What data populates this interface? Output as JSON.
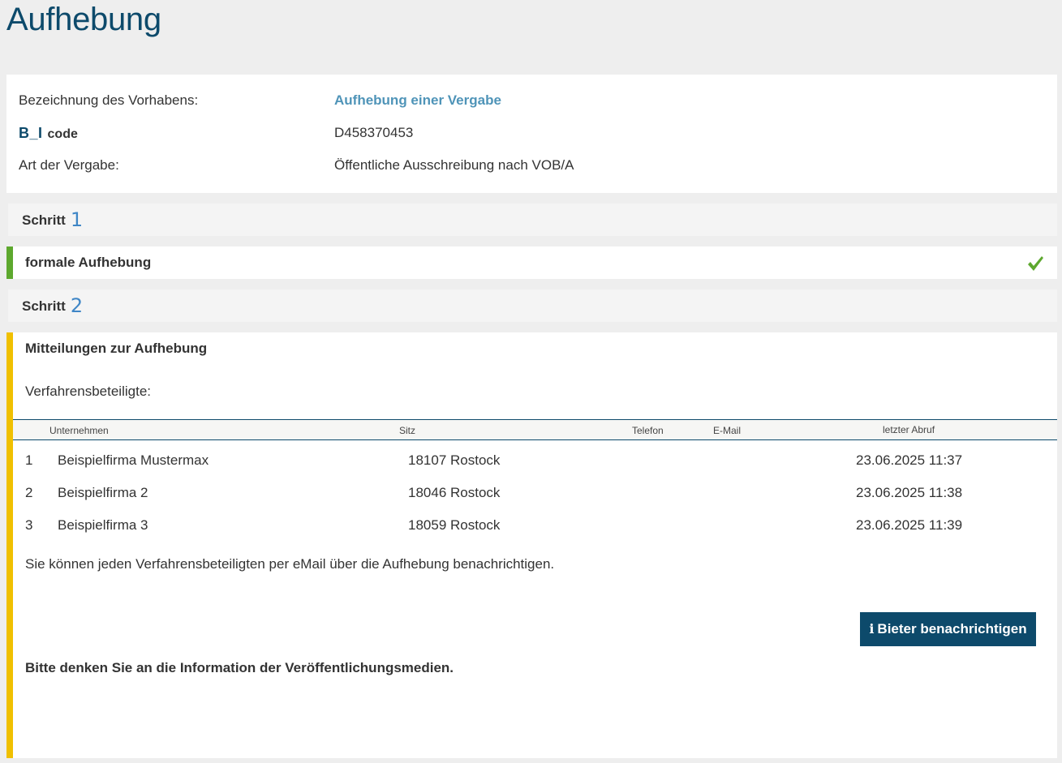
{
  "page": {
    "title": "Aufhebung"
  },
  "info": {
    "project_label": "Bezeichnung des Vorhabens:",
    "project_value": "Aufhebung einer Vergabe",
    "code_logo": "B_I",
    "code_label": "code",
    "code_value": "D458370453",
    "award_type_label": "Art der Vergabe:",
    "award_type_value": "Öffentliche Ausschreibung nach VOB/A"
  },
  "steps": [
    {
      "label": "Schritt",
      "number": "1",
      "title": "formale Aufhebung",
      "status_icon": "checkmark-icon",
      "accent": "#5da82e"
    },
    {
      "label": "Schritt",
      "number": "2",
      "title": "Mitteilungen zur Aufhebung",
      "accent": "#f0c000"
    }
  ],
  "step2": {
    "participants_label": "Verfahrensbeteiligte:",
    "table": {
      "headers": {
        "company": "Unternehmen",
        "seat": "Sitz",
        "phone": "Telefon",
        "email": "E-Mail",
        "last_access": "letzter Abruf"
      },
      "rows": [
        {
          "num": "1",
          "company": "Beispielfirma Mustermax",
          "seat": "18107 Rostock",
          "phone": "",
          "email": "",
          "last_access": "23.06.2025 11:37"
        },
        {
          "num": "2",
          "company": "Beispielfirma 2",
          "seat": "18046 Rostock",
          "phone": "",
          "email": "",
          "last_access": "23.06.2025 11:38"
        },
        {
          "num": "3",
          "company": "Beispielfirma 3",
          "seat": "18059 Rostock",
          "phone": "",
          "email": "",
          "last_access": "23.06.2025 11:39"
        }
      ]
    },
    "notify_text": "Sie können jeden Verfahrensbeteiligten per eMail über die Aufhebung benachrichtigen.",
    "notify_button": "Bieter benachrichtigen",
    "notify_button_icon": "info-icon",
    "reminder": "Bitte denken Sie an die Information der Veröffentlichungsmedien."
  },
  "colors": {
    "brand": "#0d4a6b",
    "link": "#4f94b8",
    "step_done": "#5da82e",
    "step_active": "#f0c000"
  }
}
